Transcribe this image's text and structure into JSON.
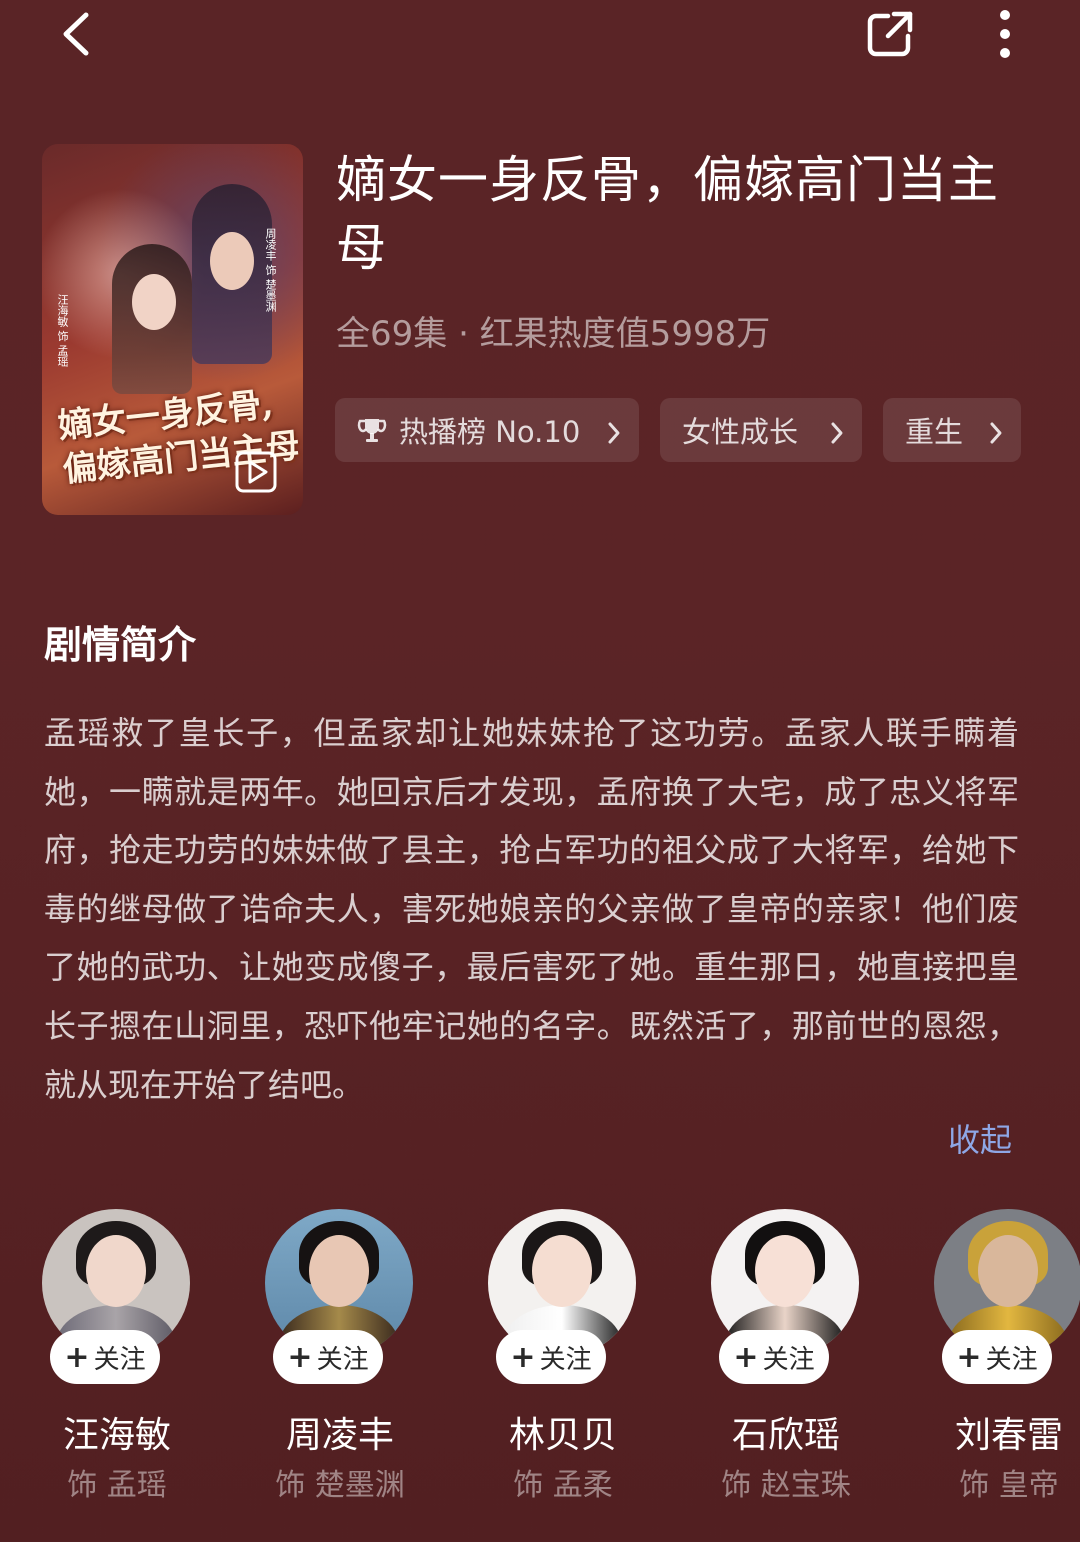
{
  "header": {
    "icons": [
      "back-arrow-icon",
      "share-icon",
      "more-vertical-icon"
    ]
  },
  "drama": {
    "title": "嫡女一身反骨，偏嫁高门当主母",
    "meta": "全69集 · 红果热度值5998万",
    "poster": {
      "title_line1": "嫡女一身反骨,",
      "title_line2": "偏嫁高门当主母",
      "cast_right": "周凌丰 饰 楚墨渊",
      "cast_left": "汪海敏 饰 孟瑶"
    },
    "tags": [
      {
        "label": "热播榜 No.10",
        "icon": "trophy-icon"
      },
      {
        "label": "女性成长"
      },
      {
        "label": "重生"
      }
    ]
  },
  "synopsis": {
    "heading": "剧情简介",
    "text": "孟瑶救了皇长子，但孟家却让她妹妹抢了这功劳。孟家人联手瞒着她，一瞒就是两年。她回京后才发现，孟府换了大宅，成了忠义将军府，抢走功劳的妹妹做了县主，抢占军功的祖父成了大将军，给她下毒的继母做了诰命夫人，害死她娘亲的父亲做了皇帝的亲家！他们废了她的武功、让她变成傻子，最后害死了她。重生那日，她直接把皇长子摁在山洞里，恐吓他牢记她的名字。既然活了，那前世的恩怨，就从现在开始了结吧。",
    "collapse_label": "收起"
  },
  "cast": {
    "follow_label": "关注",
    "members": [
      {
        "name": "汪海敏",
        "role": "饰 孟瑶"
      },
      {
        "name": "周凌丰",
        "role": "饰 楚墨渊"
      },
      {
        "name": "林贝贝",
        "role": "饰 孟柔"
      },
      {
        "name": "石欣瑶",
        "role": "饰 赵宝珠"
      },
      {
        "name": "刘春雷",
        "role": "饰 皇帝"
      }
    ]
  },
  "colors": {
    "background": "#5a2426",
    "accent_link": "#8ea7e6",
    "tag_bg": "rgba(255,255,255,0.1)"
  }
}
